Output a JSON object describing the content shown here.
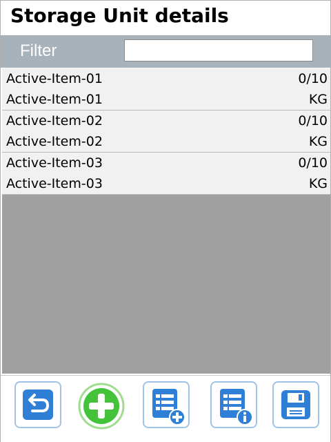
{
  "title": "Storage Unit details",
  "filter": {
    "label": "Filter",
    "value": "",
    "placeholder": ""
  },
  "items": [
    {
      "name": "Active-Item-01",
      "qty": "0/10",
      "desc": "Active-Item-01",
      "unit": "KG"
    },
    {
      "name": "Active-Item-02",
      "qty": "0/10",
      "desc": "Active-Item-02",
      "unit": "KG"
    },
    {
      "name": "Active-Item-03",
      "qty": "0/10",
      "desc": "Active-Item-03",
      "unit": "KG"
    }
  ],
  "toolbar": {
    "buttons": [
      {
        "icon": "back-arrow-icon"
      },
      {
        "icon": "add-circle-icon"
      },
      {
        "icon": "list-add-icon"
      },
      {
        "icon": "list-info-icon"
      },
      {
        "icon": "save-disk-icon"
      }
    ]
  },
  "colors": {
    "accent": "#2f7fd6",
    "add_green": "#44c23a",
    "filter_bar": "#a8b2bb",
    "list_bg": "#a0a0a0"
  }
}
